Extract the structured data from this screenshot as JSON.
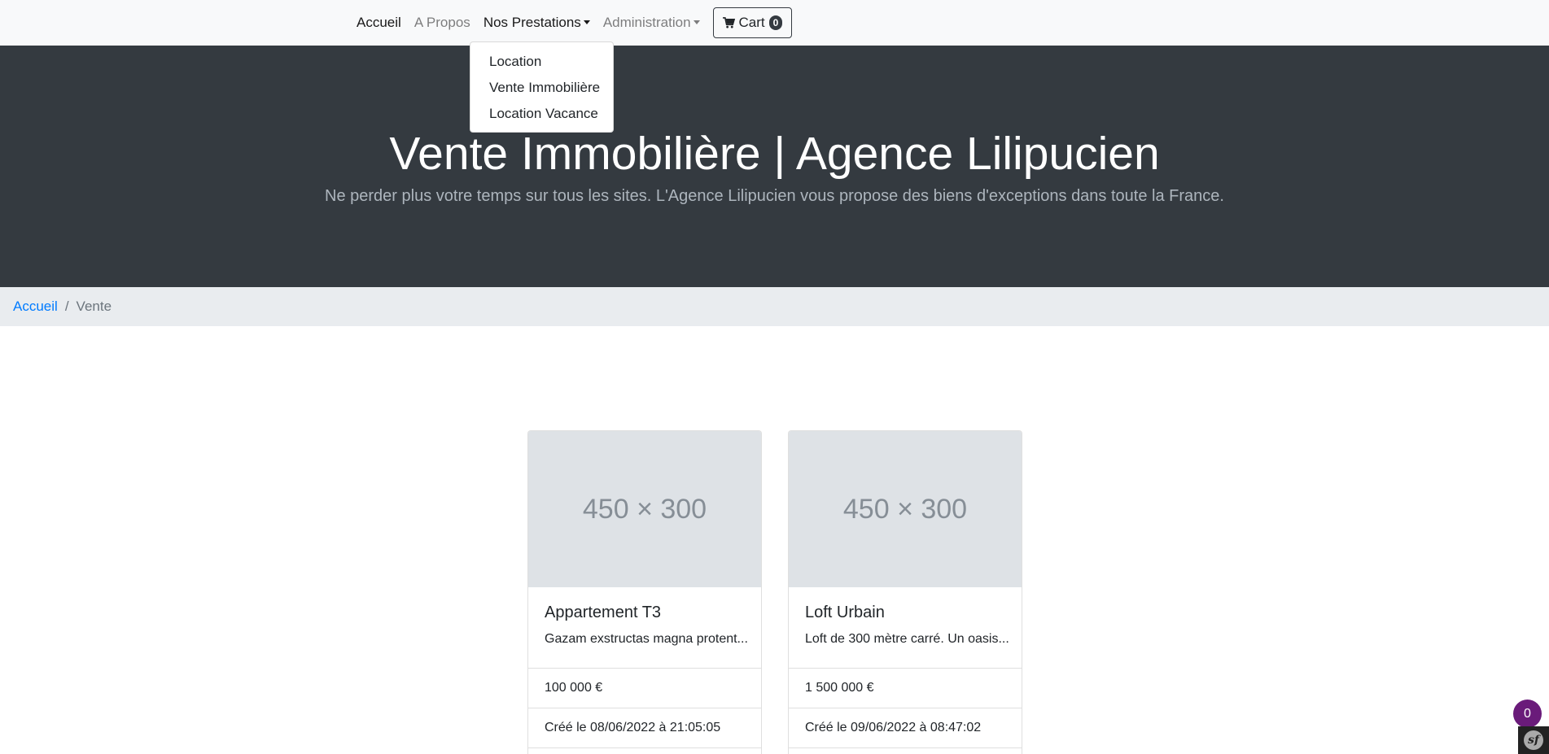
{
  "nav": {
    "home": "Accueil",
    "about": "A Propos",
    "services": "Nos Prestations",
    "admin": "Administration",
    "cart_label": "Cart",
    "cart_count": "0"
  },
  "dropdown": {
    "items": [
      "Location",
      "Vente Immobilière",
      "Location Vacance"
    ]
  },
  "hero": {
    "title": "Vente Immobilière | Agence Lilipucien",
    "lead": "Ne perder plus votre temps sur tous les sites. L'Agence Lilipucien vous propose des biens d'exceptions dans toute la France."
  },
  "breadcrumb": {
    "home": "Accueil",
    "separator": "/",
    "current": "Vente"
  },
  "cards": [
    {
      "image_placeholder": "450 × 300",
      "title": "Appartement T3",
      "text": "Gazam exstructas magna protent...",
      "price": "100 000 €",
      "created": "Créé le 08/06/2022 à 21:05:05"
    },
    {
      "image_placeholder": "450 × 300",
      "title": "Loft Urbain",
      "text": "Loft de 300 mètre carré. Un oasis...",
      "price": "1 500 000 €",
      "created": "Créé le 09/06/2022 à 08:47:02"
    }
  ],
  "debug": {
    "count": "0",
    "logo": "sf"
  }
}
